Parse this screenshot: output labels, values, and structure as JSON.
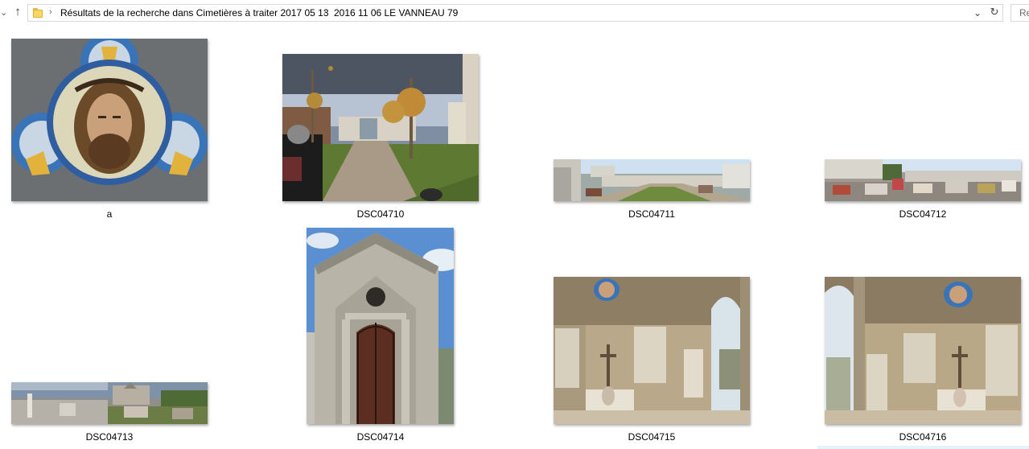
{
  "address_bar": {
    "breadcrumbs": [
      {
        "label": "Résultats de la recherche dans Cimetières à traiter 2017 05 13"
      },
      {
        "label": "2016 11 06 LE VANNEAU 79"
      }
    ],
    "search_text": "Re"
  },
  "files": [
    {
      "name": "a",
      "icon": "stained-glass-christ-image"
    },
    {
      "name": "DSC04710",
      "icon": "cemetery-path-image"
    },
    {
      "name": "DSC04711",
      "icon": "cemetery-panorama-image"
    },
    {
      "name": "DSC04712",
      "icon": "cemetery-panorama-image"
    },
    {
      "name": "DSC04713",
      "icon": "cemetery-panorama-image"
    },
    {
      "name": "DSC04714",
      "icon": "chapel-door-image"
    },
    {
      "name": "DSC04715",
      "icon": "chapel-interior-image"
    },
    {
      "name": "DSC04716",
      "icon": "chapel-interior-image"
    }
  ],
  "colors": {
    "folder": "#ffd766",
    "selection": "#e5f3fb",
    "border": "#d9d9d9"
  }
}
